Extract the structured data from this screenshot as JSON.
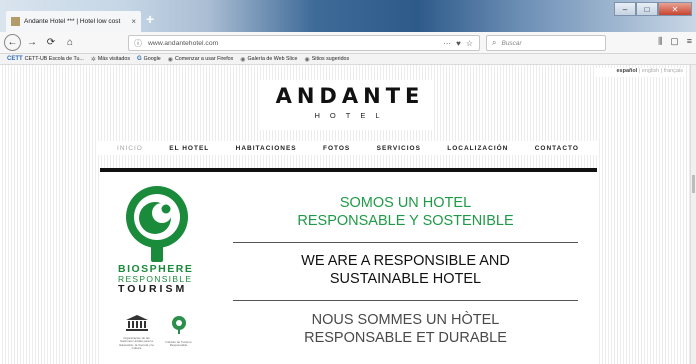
{
  "browser": {
    "tab_title": "Andante Hotel *** | Hotel low cost",
    "tab_close": "×",
    "new_tab": "+",
    "url": "www.andantehotel.com",
    "url_info": "ⓘ",
    "url_actions": [
      "···",
      "♥",
      "☆"
    ],
    "search_placeholder": "Buscar",
    "search_icon": "⌕",
    "right_icons": [
      "⫼",
      "▢",
      "≡"
    ],
    "window_buttons": [
      "–",
      "□",
      "✕"
    ],
    "nav_icons": [
      "←",
      "→",
      "⟳",
      "⌂"
    ]
  },
  "bookmarks": [
    {
      "icon": "CETT",
      "label": "CETT-UB Escola de Tu..."
    },
    {
      "icon": "✲",
      "label": "Más visitados"
    },
    {
      "icon": "G",
      "label": "Google"
    },
    {
      "icon": "◉",
      "label": "Comenzar a usar Firefox"
    },
    {
      "icon": "◉",
      "label": "Galería de Web Slice"
    },
    {
      "icon": "◉",
      "label": "Sitios sugeridos"
    }
  ],
  "site": {
    "languages": {
      "active": "español",
      "others": [
        "english",
        "français"
      ],
      "separator": "|"
    },
    "logo": {
      "main": "ANDANTE",
      "sub": "HOTEL"
    },
    "menu": [
      "INICIO",
      "EL HOTEL",
      "HABITACIONES",
      "FOTOS",
      "SERVICIOS",
      "LOCALIZACIÓN",
      "CONTACTO"
    ],
    "biosphere": {
      "line1": "BIOSPHERE",
      "line2": "RESPONSIBLE",
      "line3": "TOURISM"
    },
    "partners": {
      "unesco_caption": "Organización de las Naciones Unidas para la Educación, la Ciencia y la Cultura",
      "tree_caption": "Instituto de Turismo Responsable"
    },
    "slogans": {
      "es_line1": "SOMOS UN HOTEL",
      "es_line2": "RESPONSABLE Y SOSTENIBLE",
      "en_line1": "WE ARE A RESPONSIBLE AND",
      "en_line2": "SUSTAINABLE HOTEL",
      "fr_line1": "NOUS SOMMES UN HÒTEL",
      "fr_line2": "RESPONSABLE ET DURABLE"
    }
  },
  "colors": {
    "green": "#1f9a47",
    "biosphere_green": "#1a8a3b",
    "menu_active": "#a6a6a6"
  }
}
